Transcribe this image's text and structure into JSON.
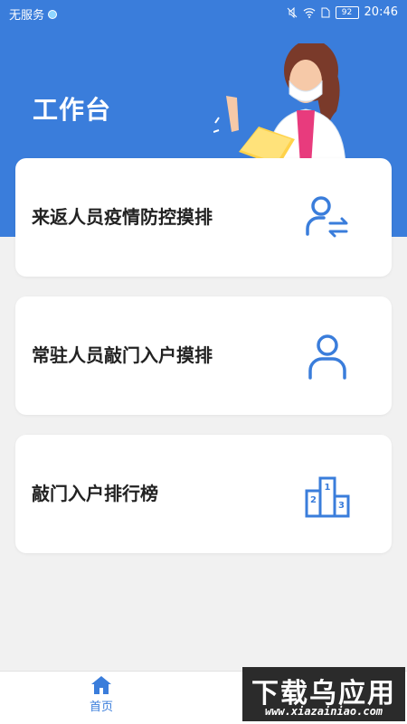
{
  "status_bar": {
    "carrier": "无服务",
    "battery": "92",
    "time": "20:46"
  },
  "header": {
    "title": "工作台"
  },
  "cards": [
    {
      "label": "来返人员疫情防控摸排",
      "icon": "person-transfer-icon"
    },
    {
      "label": "常驻人员敲门入户摸排",
      "icon": "person-icon"
    },
    {
      "label": "敲门入户排行榜",
      "icon": "podium-icon"
    }
  ],
  "tab_bar": {
    "home_label": "首页",
    "home_icon": "home-icon"
  },
  "watermark": {
    "title": "下载乌应用",
    "url": "www.xiazainiao.com"
  },
  "colors": {
    "primary": "#3a7ddb",
    "background": "#f1f1f1",
    "card": "#ffffff"
  }
}
